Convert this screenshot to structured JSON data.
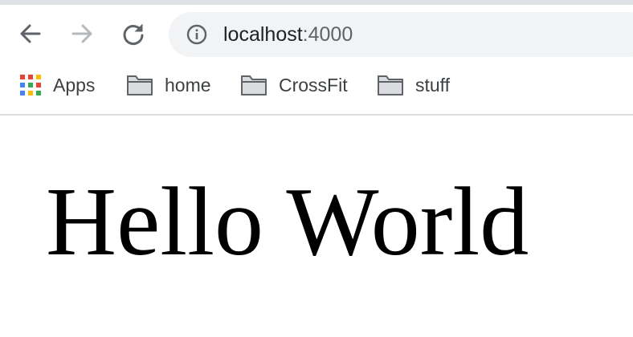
{
  "browser": {
    "url_host": "localhost",
    "url_port": ":4000",
    "icons": {
      "back": "arrow-left-icon",
      "forward": "arrow-right-icon",
      "reload": "reload-icon",
      "site_info": "info-icon",
      "apps": "apps-grid-icon",
      "folder": "folder-icon"
    },
    "bookmarks": [
      {
        "label": "Apps"
      },
      {
        "label": "home"
      },
      {
        "label": "CrossFit"
      },
      {
        "label": "stuff"
      }
    ],
    "colors": {
      "icon_active": "#5f6368",
      "icon_disabled": "#b5b8bc",
      "omnibox_bg": "#f1f3f4"
    }
  },
  "page": {
    "heading": "Hello World"
  }
}
